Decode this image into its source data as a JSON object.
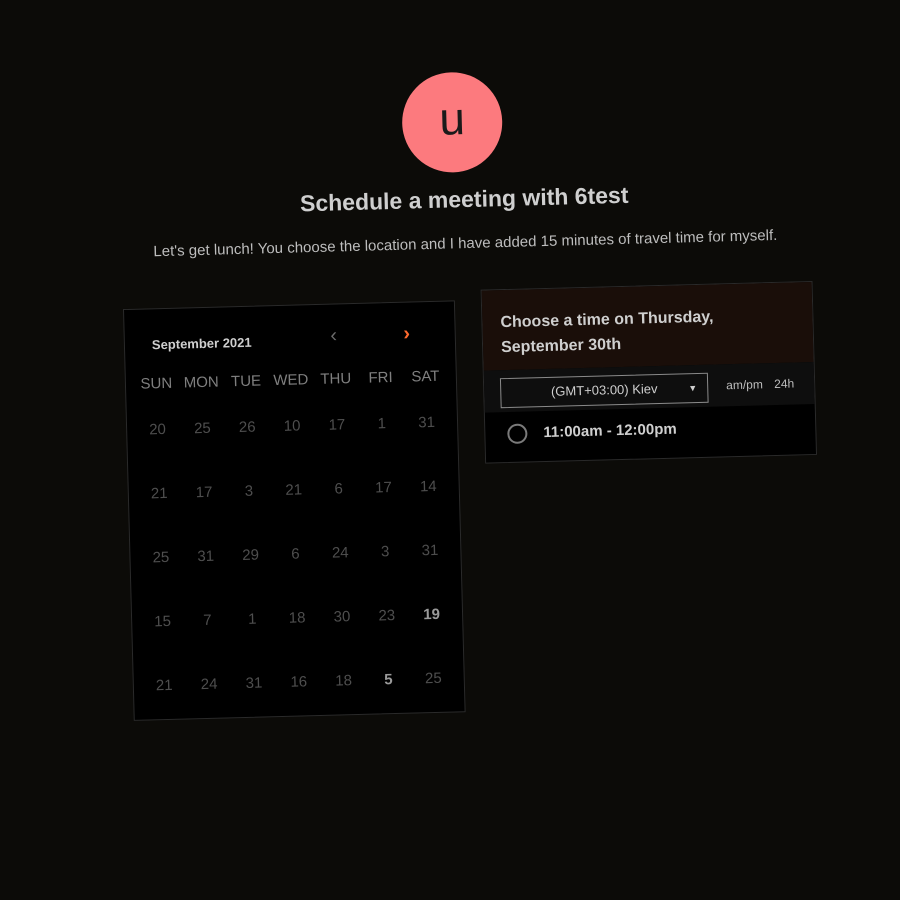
{
  "host": {
    "avatar_letter": "u",
    "avatar_color": "#fc7a7e"
  },
  "header": {
    "title": "Schedule a meeting with 6test",
    "description": "Let's get lunch! You choose the location and I have added 15 minutes of travel time for myself."
  },
  "calendar": {
    "month_label": "September 2021",
    "prev_icon": "chevron-left-icon",
    "next_icon": "chevron-right-icon",
    "accent_color": "#ff6a2e",
    "weekdays": [
      "SUN",
      "MON",
      "TUE",
      "WED",
      "THU",
      "FRI",
      "SAT"
    ],
    "weeks": [
      [
        "20",
        "25",
        "26",
        "10",
        "17",
        "1",
        "31"
      ],
      [
        "21",
        "17",
        "3",
        "21",
        "6",
        "17",
        "14"
      ],
      [
        "25",
        "31",
        "29",
        "6",
        "24",
        "3",
        "31"
      ],
      [
        "15",
        "7",
        "1",
        "18",
        "30",
        "23",
        "19"
      ],
      [
        "21",
        "24",
        "31",
        "16",
        "18",
        "5",
        "25"
      ]
    ],
    "bold_days": [
      "19",
      "5"
    ]
  },
  "time_panel": {
    "title": "Choose a time on Thursday, September 30th",
    "header_color": "#1a0e09",
    "timezone": "(GMT+03:00) Kiev",
    "format_ampm": "am/pm",
    "format_24h": "24h",
    "slots": [
      "11:00am - 12:00pm"
    ]
  }
}
